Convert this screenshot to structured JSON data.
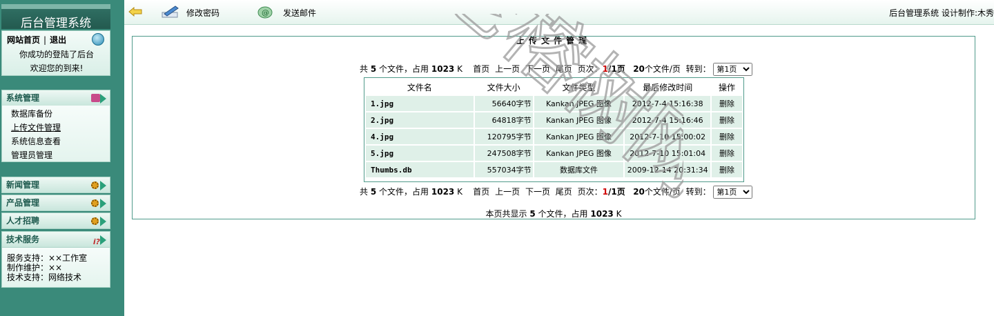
{
  "sidebar": {
    "app_title": "后台管理系统",
    "home_link": "网站首页",
    "separator": "|",
    "logout_link": "退出",
    "welcome_line1": "你成功的登陆了后台",
    "welcome_line2": "欢迎您的到来!",
    "sections": {
      "system": {
        "label": "系统管理",
        "items": [
          "数据库备份",
          "上传文件管理",
          "系统信息查看",
          "管理员管理"
        ]
      },
      "news": {
        "label": "新闻管理"
      },
      "product": {
        "label": "产品管理"
      },
      "jobs": {
        "label": "人才招聘"
      },
      "tech": {
        "label": "技术服务",
        "lines": [
          "服务支持：××工作室",
          "制作维护：××",
          "技术支持：网络技术"
        ]
      }
    }
  },
  "topbar": {
    "change_password": "修改密码",
    "send_mail": "发送邮件",
    "right_text": "后台管理系统 设计制作:木秀"
  },
  "main": {
    "title": "上传文件管理",
    "pager": {
      "total_prefix": "共",
      "file_count": "5",
      "total_mid": "个文件，占用",
      "size": "1023",
      "size_unit": "K",
      "first": "首页",
      "prev": "上一页",
      "next": "下一页",
      "last": "尾页",
      "page_label": "页次：",
      "current_page": "1",
      "total_pages": "/1页",
      "per_page": "20",
      "per_page_suffix": "个文件/页",
      "goto": "转到：",
      "select_value": "第1页"
    },
    "columns": [
      "文件名",
      "文件大小",
      "文件类型",
      "最后修改时间",
      "操作"
    ],
    "rows": [
      {
        "name": "1.jpg",
        "size": "56640字节",
        "type": "Kankan JPEG 图像",
        "date": "2012-7-4 15:16:38",
        "op": "删除"
      },
      {
        "name": "2.jpg",
        "size": "64818字节",
        "type": "Kankan JPEG 图像",
        "date": "2012-7-4 15:16:46",
        "op": "删除"
      },
      {
        "name": "4.jpg",
        "size": "120795字节",
        "type": "Kankan JPEG 图像",
        "date": "2012-7-10 15:00:02",
        "op": "删除"
      },
      {
        "name": "5.jpg",
        "size": "247508字节",
        "type": "Kankan JPEG 图像",
        "date": "2012-7-10 15:01:04",
        "op": "删除"
      },
      {
        "name": "Thumbs.db",
        "size": "557034字节",
        "type": "数据库文件",
        "date": "2009-12-14 20:31:34",
        "op": "删除"
      }
    ],
    "footer": {
      "prefix": "本页共显示",
      "count": "5",
      "mid": "个文件，占用",
      "size": "1023",
      "unit": "K"
    }
  },
  "watermark_text": "老榕树网络",
  "colors": {
    "sidebar": "#3a8a7a",
    "border": "#4f9a8a",
    "row_bg": "#dff0e8",
    "accent_red": "#d00000"
  }
}
